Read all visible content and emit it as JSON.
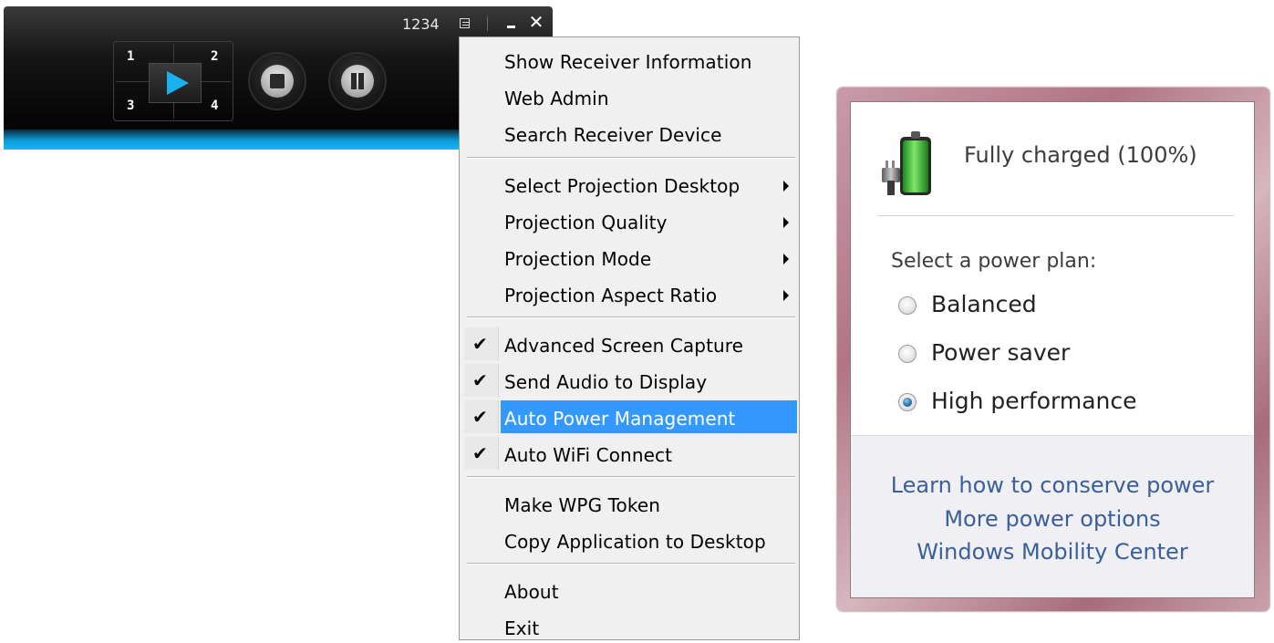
{
  "toolbar": {
    "code": "1234",
    "quadrants": [
      "1",
      "2",
      "3",
      "4"
    ],
    "accent_color": "#19b2f0",
    "icons": {
      "list": "list-icon",
      "minimize": "minimize-icon",
      "close": "close-icon",
      "play": "play-icon",
      "stop": "stop-icon",
      "pause": "pause-icon"
    }
  },
  "menu": {
    "items": [
      {
        "label": "Show Receiver Information",
        "checked": false,
        "submenu": false
      },
      {
        "label": "Web Admin",
        "checked": false,
        "submenu": false
      },
      {
        "label": "Search Receiver Device",
        "checked": false,
        "submenu": false
      },
      {
        "label": "Select Projection Desktop",
        "checked": false,
        "submenu": true
      },
      {
        "label": "Projection Quality",
        "checked": false,
        "submenu": true
      },
      {
        "label": "Projection Mode",
        "checked": false,
        "submenu": true
      },
      {
        "label": "Projection Aspect Ratio",
        "checked": false,
        "submenu": true
      },
      {
        "label": "Advanced Screen Capture",
        "checked": true,
        "submenu": false
      },
      {
        "label": "Send Audio to Display",
        "checked": true,
        "submenu": false
      },
      {
        "label": "Auto Power Management",
        "checked": true,
        "submenu": false,
        "highlighted": true
      },
      {
        "label": "Auto WiFi Connect",
        "checked": true,
        "submenu": false
      },
      {
        "label": "Make WPG Token",
        "checked": false,
        "submenu": false
      },
      {
        "label": "Copy Application to Desktop",
        "checked": false,
        "submenu": false
      },
      {
        "label": "About",
        "checked": false,
        "submenu": false
      },
      {
        "label": "Exit",
        "checked": false,
        "submenu": false
      }
    ],
    "check_glyph": "✔",
    "highlight_color": "#3399ff"
  },
  "battery": {
    "status": "Fully charged (100%)",
    "charge_percent": 100,
    "plan_heading": "Select a power plan:",
    "plans": [
      {
        "label": "Balanced",
        "selected": false
      },
      {
        "label": "Power saver",
        "selected": false
      },
      {
        "label": "High performance",
        "selected": true
      }
    ],
    "links": [
      "Learn how to conserve power",
      "More power options",
      "Windows Mobility Center"
    ],
    "link_color": "#3a5f9a"
  }
}
